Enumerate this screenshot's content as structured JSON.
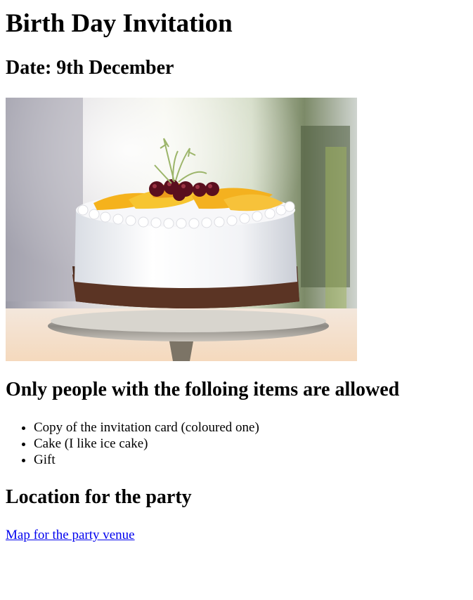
{
  "page": {
    "title": "Birth Day Invitation",
    "date": "Date: 9th December",
    "photo_subject": "cake-photo"
  },
  "requirements": {
    "heading": "Only people with the folloing items are allowed",
    "items": [
      "Copy of the invitation card (coloured one)",
      "Cake (I like ice cake)",
      "Gift"
    ]
  },
  "location": {
    "heading": "Location for the party",
    "link_text": "Map for the party venue"
  },
  "colors": {
    "link": "#0000ee",
    "text": "#000000",
    "background": "#ffffff"
  }
}
